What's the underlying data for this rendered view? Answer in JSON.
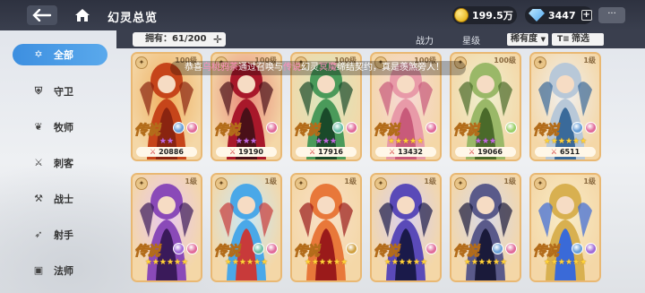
{
  "header": {
    "title": "幻灵总览",
    "gold": "199.5万",
    "gems": "3447",
    "plus": "+",
    "chat": "···"
  },
  "sidebar": {
    "items": [
      {
        "label": "全部",
        "icon": "star-emblem-icon",
        "active": true
      },
      {
        "label": "守卫",
        "icon": "shield-icon"
      },
      {
        "label": "牧师",
        "icon": "wing-icon"
      },
      {
        "label": "刺客",
        "icon": "blade-icon"
      },
      {
        "label": "战士",
        "icon": "sword-icon"
      },
      {
        "label": "射手",
        "icon": "bow-icon"
      },
      {
        "label": "法师",
        "icon": "book-icon"
      }
    ]
  },
  "filterbar": {
    "owned": "拥有：61/200",
    "sort_power": "战力",
    "sort_star": "星级",
    "sort_rarity": "稀有度",
    "filter": "筛选"
  },
  "banner": {
    "prefix": "恭喜",
    "player": "乌桃鸦茶",
    "middle": "通过召唤与",
    "rank": "传说",
    "middle2": "幻灵",
    "hero": "冥魔",
    "suffix": "缔结契约，真是羡煞旁人！"
  },
  "cards": [
    {
      "level": "100级",
      "rank": "传说",
      "stars": 2,
      "star_color": "pink",
      "power": "20886",
      "elements": [
        "#6aa0d8",
        "#e06a9a"
      ],
      "palette": [
        "#f0b060",
        "#c6451a",
        "#8a2410"
      ],
      "class": "✦"
    },
    {
      "level": "100级",
      "rank": "传说",
      "stars": 3,
      "star_color": "pink",
      "power": "19190",
      "elements": [
        "#e06a9a"
      ],
      "palette": [
        "#e88a7a",
        "#a8182a",
        "#4a1018"
      ],
      "class": "✦"
    },
    {
      "level": "100级",
      "rank": "传说",
      "stars": 3,
      "star_color": "pink",
      "power": "17916",
      "elements": [
        "#6ac0a8",
        "#e06a9a"
      ],
      "palette": [
        "#d8e8c0",
        "#4a9a5a",
        "#1a4a2a"
      ],
      "class": "✦"
    },
    {
      "level": "100级",
      "rank": "传说",
      "stars": 5,
      "star_color": "gold",
      "power": "13432",
      "elements": [
        "#e06a9a"
      ],
      "palette": [
        "#f6d8d8",
        "#e89aa8",
        "#c85a7a"
      ],
      "class": "✦"
    },
    {
      "level": "100级",
      "rank": "传说",
      "stars": 3,
      "star_color": "pink",
      "power": "19066",
      "elements": [
        "#9ad06a"
      ],
      "palette": [
        "#eef0d0",
        "#9ab868",
        "#4a6a2a"
      ],
      "class": "✦"
    },
    {
      "level": "1级",
      "rank": "传说",
      "stars": 6,
      "star_color": "gold",
      "power": "6511",
      "elements": [
        "#6aa0d8",
        "#e06a9a"
      ],
      "palette": [
        "#f0f0f0",
        "#b8c8d8",
        "#3a6a9a"
      ],
      "class": "✦"
    },
    {
      "level": "1级",
      "rank": "传说",
      "stars": 6,
      "star_color": "gold",
      "power": "",
      "elements": [
        "#a06ad8",
        "#e06a9a"
      ],
      "palette": [
        "#e8c8f0",
        "#8a4ab8",
        "#3a1a5a"
      ],
      "class": "✦"
    },
    {
      "level": "1级",
      "rank": "传说",
      "stars": 6,
      "star_color": "gold",
      "power": "",
      "elements": [
        "#6ac0a8",
        "#e06a9a"
      ],
      "palette": [
        "#c8e8f8",
        "#4aa8e8",
        "#c83a3a"
      ],
      "class": "✦"
    },
    {
      "level": "1级",
      "rank": "传说",
      "stars": 6,
      "star_color": "gold",
      "power": "",
      "elements": [
        "#d0a040"
      ],
      "palette": [
        "#f8e0c8",
        "#e8783a",
        "#9a1a1a"
      ],
      "class": "✦"
    },
    {
      "level": "1级",
      "rank": "传说",
      "stars": 6,
      "star_color": "gold",
      "power": "",
      "elements": [
        "#e06a9a"
      ],
      "palette": [
        "#d8d0f0",
        "#5a4ab8",
        "#1a1a4a"
      ],
      "class": "✦"
    },
    {
      "level": "1级",
      "rank": "传说",
      "stars": 6,
      "star_color": "gold",
      "power": "",
      "elements": [
        "#6aa0d8",
        "#e06a9a"
      ],
      "palette": [
        "#d8d8e8",
        "#5a5a8a",
        "#1a1a3a"
      ],
      "class": "✦"
    },
    {
      "level": "1级",
      "rank": "传说",
      "stars": 6,
      "star_color": "gold",
      "power": "",
      "elements": [
        "#6aa0d8",
        "#a06ad8"
      ],
      "palette": [
        "#f8ecc8",
        "#d8b050",
        "#3a6ad8"
      ],
      "class": "✦"
    }
  ]
}
